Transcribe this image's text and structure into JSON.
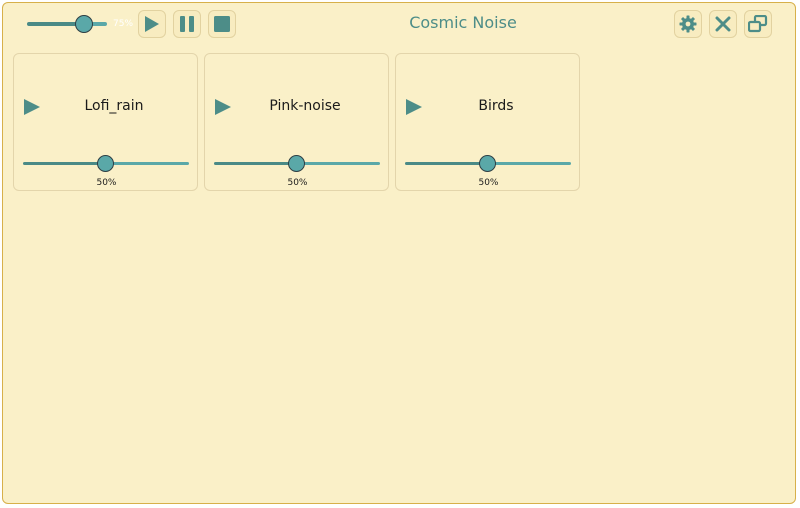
{
  "window": {
    "title": "Cosmic Noise"
  },
  "master": {
    "volume_label": "75%",
    "volume": 0.75
  },
  "toolbar": {
    "play_icon": "play-icon",
    "pause_icon": "pause-icon",
    "stop_icon": "stop-icon",
    "settings_icon": "gear-icon",
    "close_icon": "close-icon",
    "restore_icon": "restore-window-icon"
  },
  "tracks": [
    {
      "name": "Lofi_rain",
      "volume_label": "50%",
      "volume": 0.5
    },
    {
      "name": "Pink-noise",
      "volume_label": "50%",
      "volume": 0.5
    },
    {
      "name": "Birds",
      "volume_label": "50%",
      "volume": 0.5
    }
  ],
  "colors": {
    "background": "#faf0c8",
    "accent": "#4d8d88",
    "slider_fill": "#5aa8a8",
    "border": "#d7b04a"
  }
}
